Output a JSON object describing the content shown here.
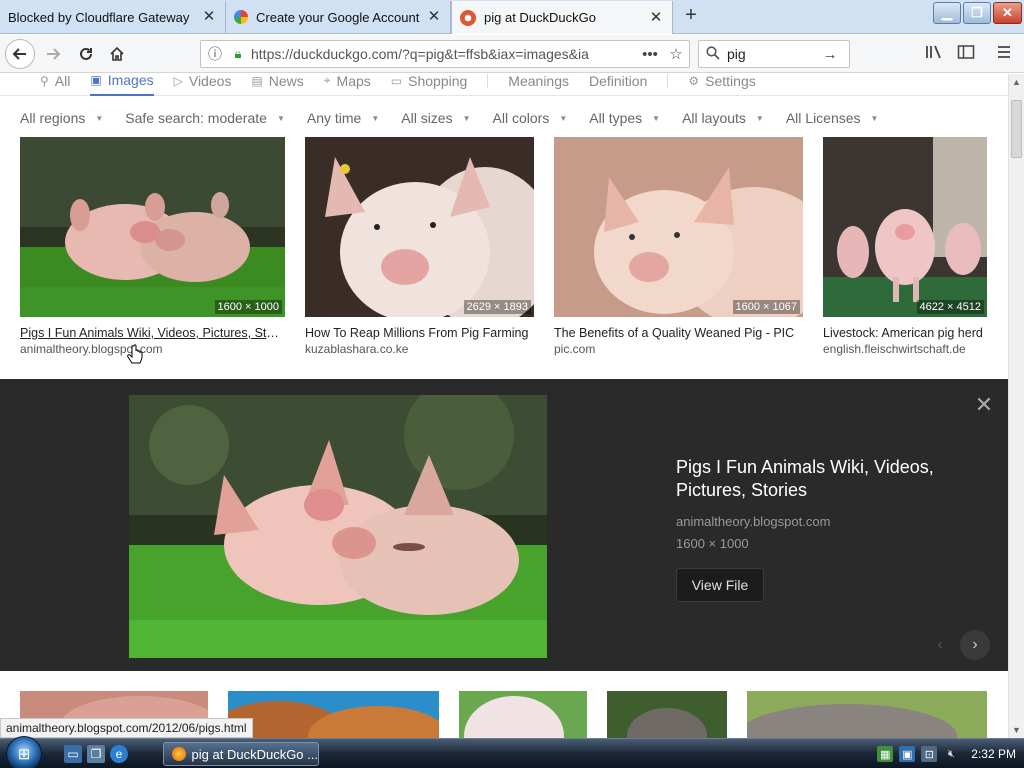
{
  "browser": {
    "tabs": [
      {
        "title": "Blocked by Cloudflare Gateway",
        "active": false
      },
      {
        "title": "Create your Google Account",
        "active": false
      },
      {
        "title": "pig at DuckDuckGo",
        "active": true
      }
    ],
    "new_tab_label": "+",
    "url": "https://duckduckgo.com/?q=pig&t=ffsb&iax=images&ia",
    "search_query": "pig",
    "status_url": "animaltheory.blogspot.com/2012/06/pigs.html"
  },
  "ddg": {
    "nav_tabs": [
      {
        "label": "All",
        "icon": "search-icon",
        "selected": false
      },
      {
        "label": "Images",
        "icon": "image-icon",
        "selected": true
      },
      {
        "label": "Videos",
        "icon": "video-icon",
        "selected": false
      },
      {
        "label": "News",
        "icon": "news-icon",
        "selected": false
      },
      {
        "label": "Maps",
        "icon": "map-pin-icon",
        "selected": false
      },
      {
        "label": "Shopping",
        "icon": "shopping-bag-icon",
        "selected": false
      },
      {
        "label": "Meanings",
        "icon": "",
        "selected": false
      },
      {
        "label": "Definition",
        "icon": "",
        "selected": false
      },
      {
        "label": "Settings",
        "icon": "settings-icon",
        "selected": false
      }
    ],
    "filters": [
      "All regions",
      "Safe search: moderate",
      "Any time",
      "All sizes",
      "All colors",
      "All types",
      "All layouts",
      "All Licenses"
    ],
    "results": [
      {
        "title": "Pigs I Fun Animals Wiki, Videos, Pictures, Stories",
        "source": "animaltheory.blogspot.com",
        "dims": "1600 × 1000"
      },
      {
        "title": "How To Reap Millions From Pig Farming",
        "source": "kuzablashara.co.ke",
        "dims": "2629 × 1893"
      },
      {
        "title": "The Benefits of a Quality Weaned Pig - PIC",
        "source": "pic.com",
        "dims": "1600 × 1067"
      },
      {
        "title": "Livestock: American pig herd",
        "source": "english.fleischwirtschaft.de",
        "dims": "4622 × 4512"
      }
    ],
    "detail": {
      "title": "Pigs I Fun Animals Wiki, Videos, Pictures, Stories",
      "source": "animaltheory.blogspot.com",
      "dims": "1600 × 1000",
      "view_file_label": "View File"
    }
  },
  "taskbar": {
    "active_window": "pig at DuckDuckGo ...",
    "clock": "2:32 PM"
  },
  "colors": {
    "accent": "#4a75c9",
    "detail_bg": "#2a2a2a",
    "tab_strip": "#cfe1f3"
  }
}
